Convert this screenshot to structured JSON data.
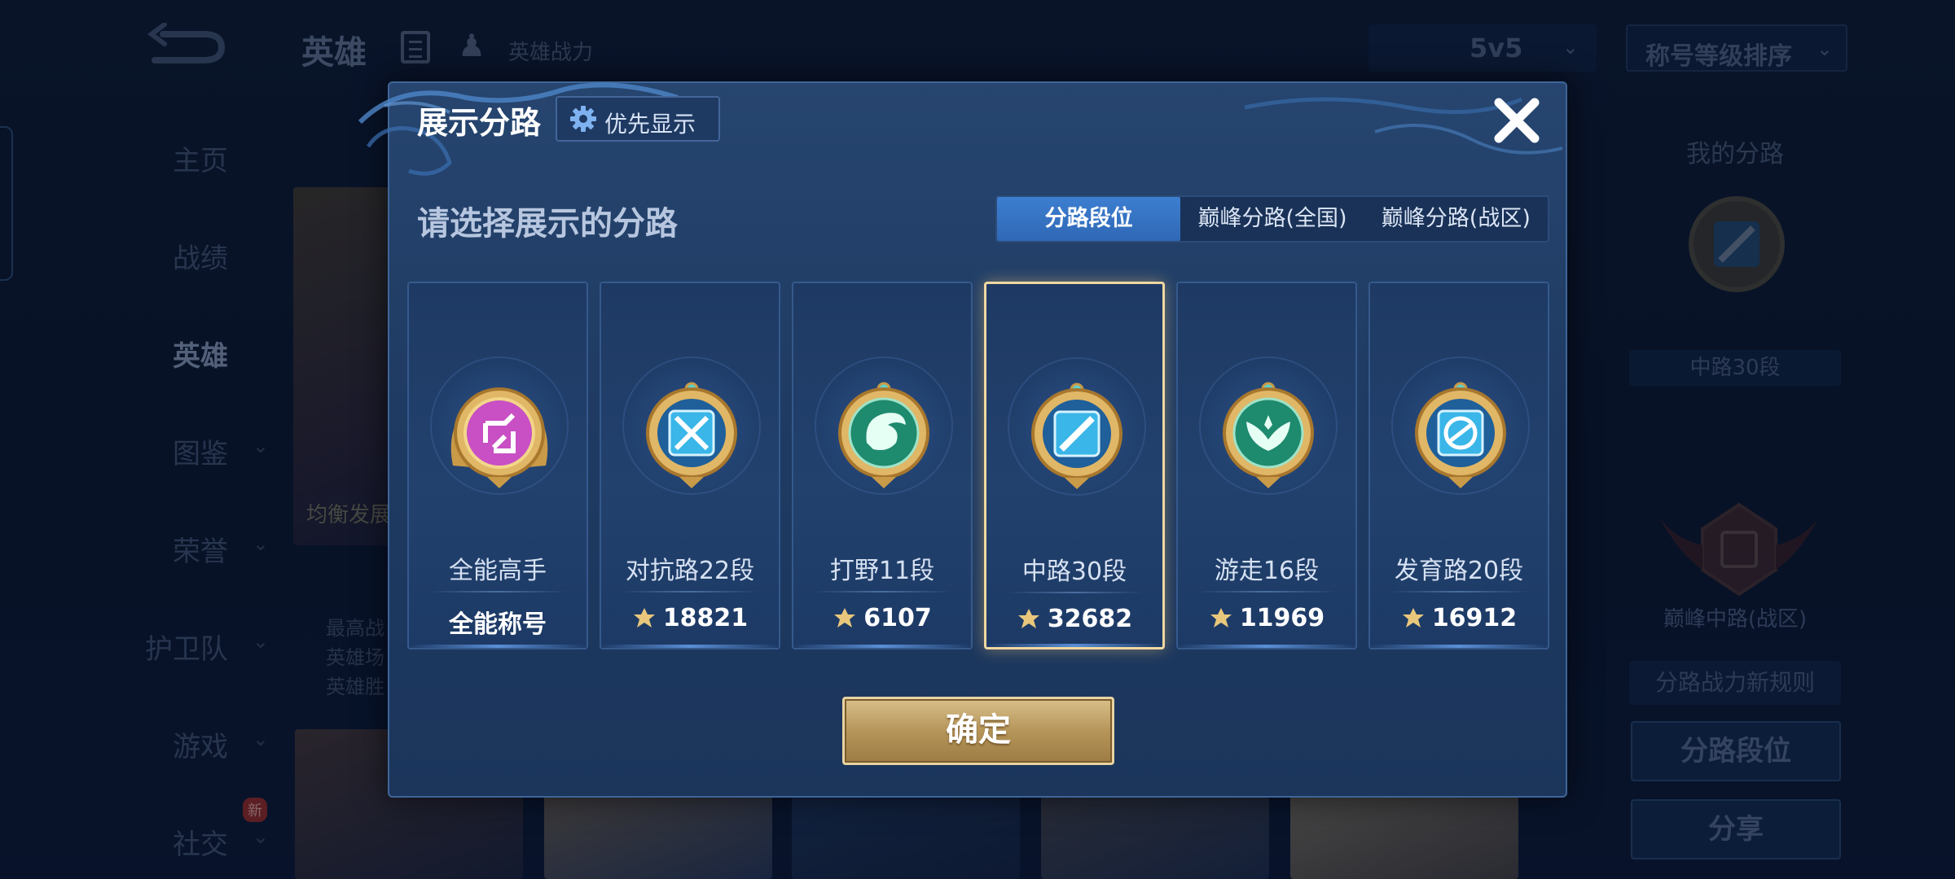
{
  "background": {
    "top_bar": {
      "title": "英雄",
      "hero_power_label": "英雄战力",
      "mode_value": "5v5",
      "sort_value": "称号等级排序"
    },
    "nav": [
      {
        "label": "主页",
        "has_chevron": false
      },
      {
        "label": "战绩",
        "has_chevron": false
      },
      {
        "label": "英雄",
        "has_chevron": false,
        "active": true
      },
      {
        "label": "图鉴",
        "has_chevron": true
      },
      {
        "label": "荣誉",
        "has_chevron": true
      },
      {
        "label": "护卫队",
        "has_chevron": true
      },
      {
        "label": "游戏",
        "has_chevron": true
      },
      {
        "label": "社交",
        "has_chevron": true,
        "badge": "新"
      }
    ],
    "hero_card": {
      "label": "均衡发展",
      "desc_lines": [
        "最高战",
        "英雄场",
        "英雄胜"
      ]
    },
    "right_panel": {
      "title": "我的分路",
      "rank_label": "中路30段",
      "peak_label": "巅峰中路(战区)",
      "rules_label": "分路战力新规则",
      "rank_button": "分路段位",
      "share_button": "分享"
    }
  },
  "modal": {
    "title": "展示分路",
    "priority_button": "优先显示",
    "subtitle": "请选择展示的分路",
    "tabs": [
      {
        "label": "分路段位",
        "active": true
      },
      {
        "label": "巅峰分路(全国)",
        "active": false
      },
      {
        "label": "巅峰分路(战区)",
        "active": false
      }
    ],
    "cards": [
      {
        "name": "全能高手",
        "value": "全能称号",
        "show_power_icon": false,
        "badge_color": "#c84fc4",
        "icon": "all-round-icon",
        "selected": false
      },
      {
        "name": "对抗路22段",
        "value": "18821",
        "show_power_icon": true,
        "badge_color": "#3ab6e8",
        "icon": "clash-lane-icon",
        "selected": false
      },
      {
        "name": "打野11段",
        "value": "6107",
        "show_power_icon": true,
        "badge_color": "#1e8a6e",
        "icon": "jungle-icon",
        "selected": false
      },
      {
        "name": "中路30段",
        "value": "32682",
        "show_power_icon": true,
        "badge_color": "#3ab6e8",
        "icon": "mid-lane-icon",
        "selected": true
      },
      {
        "name": "游走16段",
        "value": "11969",
        "show_power_icon": true,
        "badge_color": "#1e8a6e",
        "icon": "roam-icon",
        "selected": false
      },
      {
        "name": "发育路20段",
        "value": "16912",
        "show_power_icon": true,
        "badge_color": "#3ab6e8",
        "icon": "farm-lane-icon",
        "selected": false
      }
    ],
    "confirm_button": "确定"
  },
  "colors": {
    "accent_gold": "#e7d3a2",
    "tab_active": "#3d7ed0",
    "modal_bg": "#22416d"
  }
}
